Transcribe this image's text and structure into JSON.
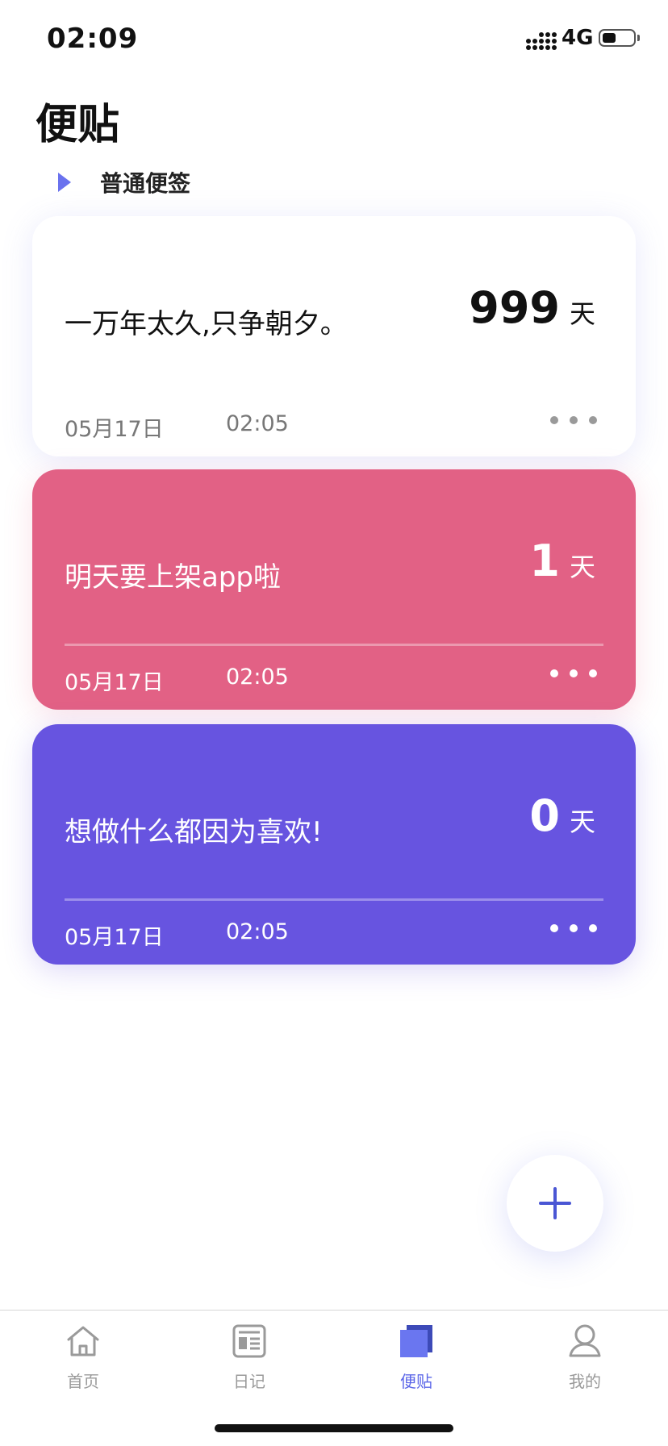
{
  "status_bar": {
    "time": "02:09",
    "network": "4G",
    "battery_percent": 45
  },
  "page": {
    "title": "便贴"
  },
  "category": {
    "label": "普通便签",
    "icon": "triangle-right-icon"
  },
  "notes": [
    {
      "text": "一万年太久,只争朝夕。",
      "days": "999",
      "days_unit": "天",
      "date": "05月17日",
      "time": "02:05",
      "color": "#ffffff"
    },
    {
      "text": "明天要上架app啦",
      "days": "1",
      "days_unit": "天",
      "date": "05月17日",
      "time": "02:05",
      "color": "#e26185"
    },
    {
      "text": "想做什么都因为喜欢!",
      "days": "0",
      "days_unit": "天",
      "date": "05月17日",
      "time": "02:05",
      "color": "#6754e0"
    }
  ],
  "fab": {
    "icon": "plus-icon",
    "accent": "#4a56d4"
  },
  "tabs": [
    {
      "label": "首页",
      "icon": "home-icon",
      "active": false
    },
    {
      "label": "日记",
      "icon": "diary-icon",
      "active": false
    },
    {
      "label": "便贴",
      "icon": "sticky-note-icon",
      "active": true
    },
    {
      "label": "我的",
      "icon": "profile-icon",
      "active": false
    }
  ],
  "accent_color": "#5b66e8"
}
